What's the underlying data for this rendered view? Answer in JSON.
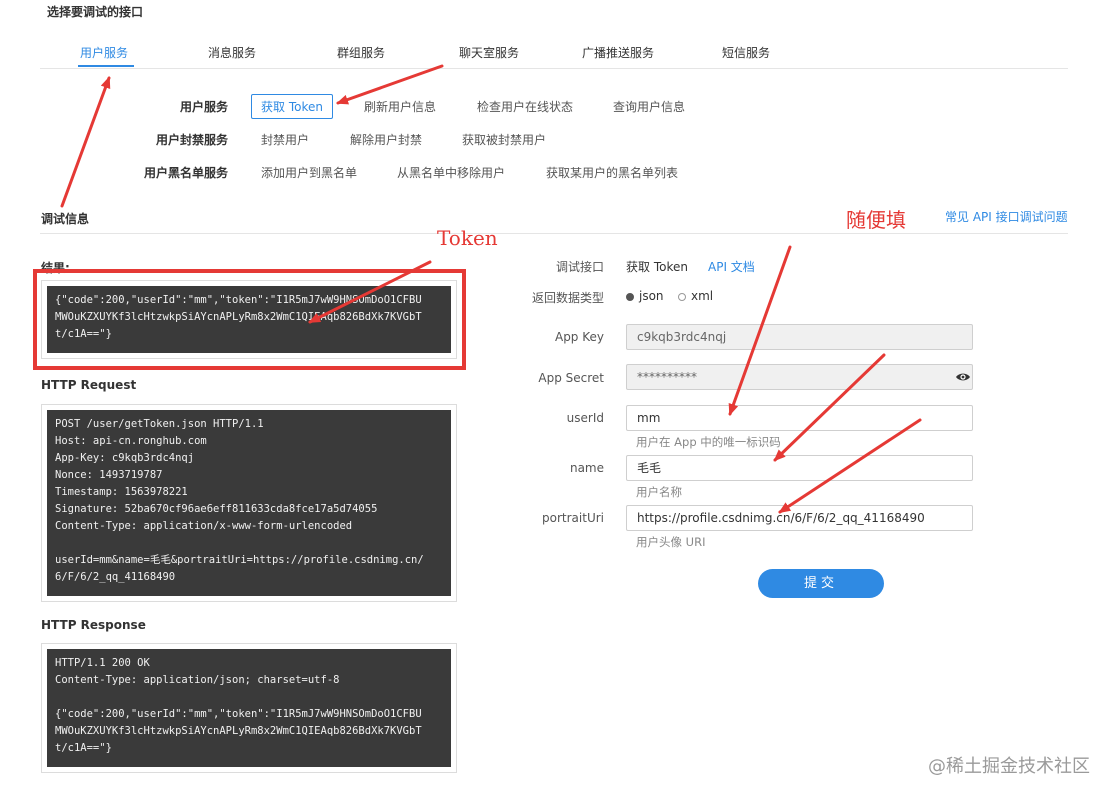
{
  "header": {
    "title": "选择要调试的接口"
  },
  "tabs": [
    {
      "label": "用户服务",
      "active": true
    },
    {
      "label": "消息服务"
    },
    {
      "label": "群组服务"
    },
    {
      "label": "聊天室服务"
    },
    {
      "label": "广播推送服务"
    },
    {
      "label": "短信服务"
    }
  ],
  "api_rows": [
    {
      "label": "用户服务",
      "ops": [
        "获取 Token",
        "刷新用户信息",
        "检查用户在线状态",
        "查询用户信息"
      ]
    },
    {
      "label": "用户封禁服务",
      "ops": [
        "封禁用户",
        "解除用户封禁",
        "获取被封禁用户"
      ]
    },
    {
      "label": "用户黑名单服务",
      "ops": [
        "添加用户到黑名单",
        "从黑名单中移除用户",
        "获取某用户的黑名单列表"
      ]
    }
  ],
  "debug": {
    "title": "调试信息",
    "faq_link": "常见 API 接口调试问题",
    "result_label": "结果:",
    "result_text": "{\"code\":200,\"userId\":\"mm\",\"token\":\"I1R5mJ7wW9HNSOmDoO1CFBU\nMWOuKZXUYKf3lcHtzwkpSiAYcnAPLyRm8x2WmC1QIEAqb826BdXk7KVGbT\nt/c1A==\"}",
    "request_title": "HTTP Request",
    "request_text": "POST /user/getToken.json HTTP/1.1\nHost: api-cn.ronghub.com\nApp-Key: c9kqb3rdc4nqj\nNonce: 1493719787\nTimestamp: 1563978221\nSignature: 52ba670cf96ae6eff811633cda8fce17a5d74055\nContent-Type: application/x-www-form-urlencoded\n\nuserId=mm&name=毛毛&portraitUri=https://profile.csdnimg.cn/\n6/F/6/2_qq_41168490",
    "response_title": "HTTP Response",
    "response_text": "HTTP/1.1 200 OK\nContent-Type: application/json; charset=utf-8\n\n{\"code\":200,\"userId\":\"mm\",\"token\":\"I1R5mJ7wW9HNSOmDoO1CFBU\nMWOuKZXUYKf3lcHtzwkpSiAYcnAPLyRm8x2WmC1QIEAqb826BdXk7KVGbT\nt/c1A==\"}"
  },
  "form": {
    "interface_label": "调试接口",
    "interface_value": "获取 Token",
    "api_doc_link": "API 文档",
    "return_type_label": "返回数据类型",
    "return_type_options": [
      "json",
      "xml"
    ],
    "return_type_selected": "json",
    "app_key_label": "App Key",
    "app_key_value": "c9kqb3rdc4nqj",
    "app_secret_label": "App Secret",
    "app_secret_value": "**********",
    "userid_label": "userId",
    "userid_value": "mm",
    "userid_hint": "用户在 App 中的唯一标识码",
    "name_label": "name",
    "name_value": "毛毛",
    "name_hint": "用户名称",
    "portrait_label": "portraitUri",
    "portrait_value": "https://profile.csdnimg.cn/6/F/6/2_qq_41168490",
    "portrait_hint": "用户头像 URI",
    "submit_label": "提交"
  },
  "annotations": {
    "token_label": "Token",
    "fill_label": "随便填",
    "color": "#e53935"
  },
  "watermark": "@稀土掘金技术社区",
  "colors": {
    "accent": "#2f8ae3",
    "annotation": "#e53935",
    "code_bg": "#3a3a3a"
  }
}
